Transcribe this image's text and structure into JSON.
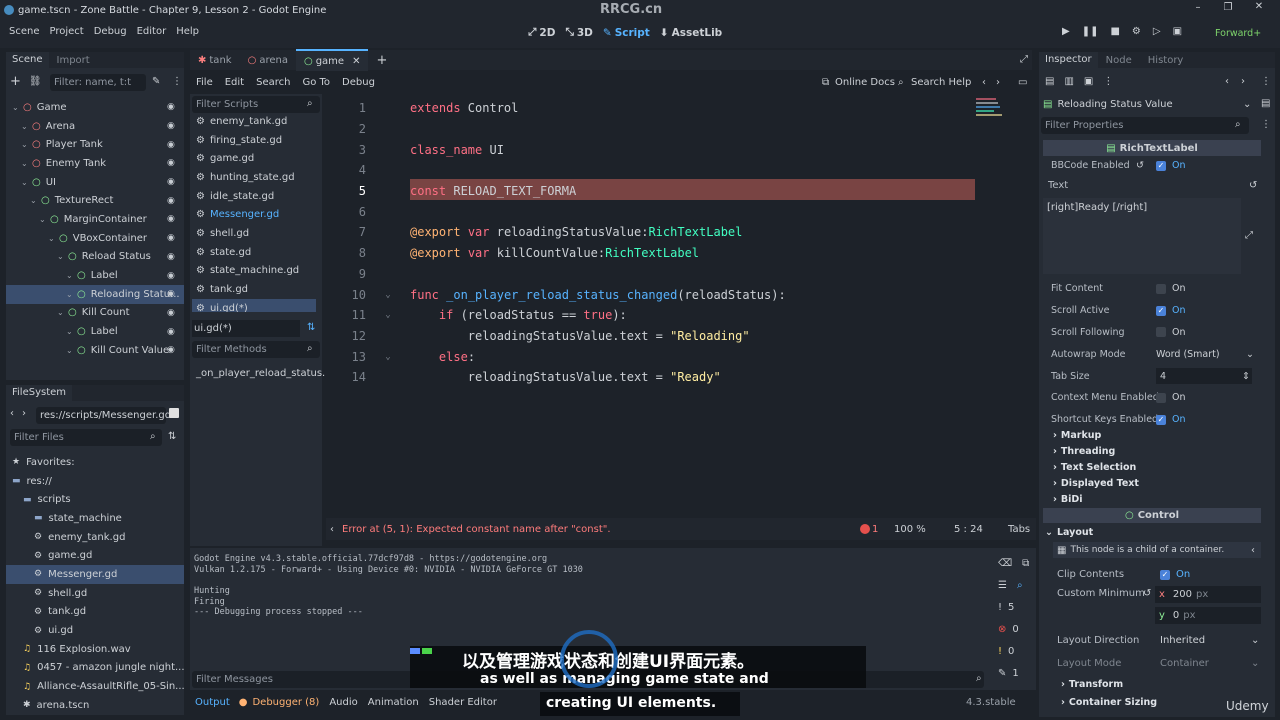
{
  "window": {
    "title": "game.tscn - Zone Battle - Chapter 9, Lesson 2 - Godot Engine",
    "watermark": "RRCG.cn"
  },
  "menu": {
    "items": [
      "Scene",
      "Project",
      "Debug",
      "Editor",
      "Help"
    ]
  },
  "workspaces": {
    "items": [
      "2D",
      "3D",
      "Script",
      "AssetLib"
    ],
    "active": "Script",
    "renderer": "Forward+"
  },
  "scene_dock": {
    "tabs": [
      "Scene",
      "Import"
    ],
    "filter_placeholder": "Filter: name, t:t",
    "nodes": [
      {
        "label": "Game",
        "indent": 0
      },
      {
        "label": "Arena",
        "indent": 1
      },
      {
        "label": "Player Tank",
        "indent": 1
      },
      {
        "label": "Enemy Tank",
        "indent": 1
      },
      {
        "label": "UI",
        "indent": 1
      },
      {
        "label": "TextureRect",
        "indent": 2
      },
      {
        "label": "MarginContainer",
        "indent": 3
      },
      {
        "label": "VBoxContainer",
        "indent": 4
      },
      {
        "label": "Reload Status",
        "indent": 5
      },
      {
        "label": "Label",
        "indent": 6
      },
      {
        "label": "Reloading Statu...",
        "indent": 6
      },
      {
        "label": "Kill Count",
        "indent": 5
      },
      {
        "label": "Label",
        "indent": 6
      },
      {
        "label": "Kill Count Value",
        "indent": 6
      }
    ],
    "selected_index": 10
  },
  "filesystem": {
    "tab": "FileSystem",
    "path": "res://scripts/Messenger.gd",
    "filter_placeholder": "Filter Files",
    "items": [
      {
        "label": "Favorites:",
        "indent": 0
      },
      {
        "label": "res://",
        "indent": 0
      },
      {
        "label": "scripts",
        "indent": 1
      },
      {
        "label": "state_machine",
        "indent": 2
      },
      {
        "label": "enemy_tank.gd",
        "indent": 2
      },
      {
        "label": "game.gd",
        "indent": 2
      },
      {
        "label": "Messenger.gd",
        "indent": 2
      },
      {
        "label": "shell.gd",
        "indent": 2
      },
      {
        "label": "tank.gd",
        "indent": 2
      },
      {
        "label": "ui.gd",
        "indent": 2
      },
      {
        "label": "116 Explosion.wav",
        "indent": 1
      },
      {
        "label": "0457 - amazon jungle night...",
        "indent": 1
      },
      {
        "label": "Alliance-AssaultRifle_05-Sin...",
        "indent": 1
      },
      {
        "label": "arena.tscn",
        "indent": 1
      }
    ],
    "selected_index": 6
  },
  "editor_tabs": {
    "items": [
      "tank",
      "arena",
      "game"
    ],
    "active": "game"
  },
  "script_menu": {
    "items": [
      "File",
      "Edit",
      "Search",
      "Go To",
      "Debug"
    ],
    "online_docs": "Online Docs",
    "search_help": "Search Help"
  },
  "script_list": {
    "filter_placeholder": "Filter Scripts",
    "items": [
      "enemy_tank.gd",
      "firing_state.gd",
      "game.gd",
      "hunting_state.gd",
      "idle_state.gd",
      "Messenger.gd",
      "shell.gd",
      "state.gd",
      "state_machine.gd",
      "tank.gd",
      "ui.gd(*)"
    ],
    "selected_index": 10,
    "current": "ui.gd(*)",
    "methods_placeholder": "Filter Methods",
    "methods": [
      "_on_player_reload_status..."
    ]
  },
  "code": {
    "lines": [
      {
        "n": "1",
        "t": [
          [
            "kw",
            "extends"
          ],
          [
            "",
            " Control"
          ]
        ]
      },
      {
        "n": "2",
        "t": []
      },
      {
        "n": "3",
        "t": [
          [
            "kw",
            "class_name"
          ],
          [
            "",
            " UI"
          ]
        ]
      },
      {
        "n": "4",
        "t": []
      },
      {
        "n": "5",
        "t": [
          [
            "kw",
            "const"
          ],
          [
            "",
            " RELOAD_TEXT_FORMA"
          ]
        ]
      },
      {
        "n": "6",
        "t": []
      },
      {
        "n": "7",
        "t": [
          [
            "an",
            "@export"
          ],
          [
            "",
            " "
          ],
          [
            "kw",
            "var"
          ],
          [
            "",
            " reloadingStatusValue:"
          ],
          [
            "ty",
            "RichTextLabel"
          ]
        ]
      },
      {
        "n": "8",
        "t": [
          [
            "an",
            "@export"
          ],
          [
            "",
            " "
          ],
          [
            "kw",
            "var"
          ],
          [
            "",
            " killCountValue:"
          ],
          [
            "ty",
            "RichTextLabel"
          ]
        ]
      },
      {
        "n": "9",
        "t": []
      },
      {
        "n": "10",
        "t": [
          [
            "kw",
            "func"
          ],
          [
            "",
            " "
          ],
          [
            "fn",
            "_on_player_reload_status_changed"
          ],
          [
            "",
            "(reloadStatus):"
          ]
        ]
      },
      {
        "n": "11",
        "t": [
          [
            "",
            "    "
          ],
          [
            "kw",
            "if"
          ],
          [
            "",
            " (reloadStatus == "
          ],
          [
            "kw",
            "true"
          ],
          [
            "",
            "):"
          ]
        ]
      },
      {
        "n": "12",
        "t": [
          [
            "",
            "        reloadingStatusValue.text = "
          ],
          [
            "st",
            "\"Reloading\""
          ]
        ]
      },
      {
        "n": "13",
        "t": [
          [
            "",
            "    "
          ],
          [
            "kw",
            "else"
          ],
          [
            "",
            ":"
          ]
        ]
      },
      {
        "n": "14",
        "t": [
          [
            "",
            "        reloadingStatusValue.text = "
          ],
          [
            "st",
            "\"Ready\""
          ]
        ]
      }
    ],
    "error_line": "5",
    "status_error": "Error at (5, 1): Expected constant name after \"const\".",
    "error_count": "1",
    "zoom": "100 %",
    "cursor": "5 :  24",
    "indent_mode": "Tabs"
  },
  "output": {
    "lines": [
      "Godot Engine v4.3.stable.official.77dcf97d8 - https://godotengine.org",
      "Vulkan 1.2.175 - Forward+ - Using Device #0: NVIDIA - NVIDIA GeForce GT 1030",
      "",
      "Hunting",
      "Firing",
      "--- Debugging process stopped ---"
    ],
    "filter_placeholder": "Filter Messages",
    "counters": [
      "5",
      "0",
      "0",
      "1"
    ]
  },
  "bottom_tabs": {
    "items": [
      "Output",
      "Debugger (8)",
      "Audio",
      "Animation",
      "Shader Editor"
    ],
    "version": "4.3.stable"
  },
  "inspector": {
    "tabs": [
      "Inspector",
      "Node",
      "History"
    ],
    "object": "Reloading Status Value",
    "filter_placeholder": "Filter Properties",
    "class": "RichTextLabel",
    "props": [
      {
        "label": "BBCode Enabled",
        "value": "On",
        "checked": true
      },
      {
        "label": "Fit Content",
        "value": "On",
        "checked": false
      },
      {
        "label": "Scroll Active",
        "value": "On",
        "checked": true
      },
      {
        "label": "Scroll Following",
        "value": "On",
        "checked": false
      },
      {
        "label": "Autowrap Mode",
        "value": "Word (Smart)",
        "checked": null
      },
      {
        "label": "Tab Size",
        "value": "4",
        "checked": null
      },
      {
        "label": "Context Menu Enabled",
        "value": "On",
        "checked": false
      },
      {
        "label": "Shortcut Keys Enabled",
        "value": "On",
        "checked": true
      }
    ],
    "text_label": "Text",
    "text_value": "[right]Ready [/right]",
    "sections": [
      "Markup",
      "Threading",
      "Text Selection",
      "Displayed Text",
      "BiDi"
    ],
    "control_class": "Control",
    "layout_section": "Layout",
    "container_note": "This node is a child of a container.",
    "clip_label": "Clip Contents",
    "clip_value": "On",
    "min_label": "Custom Minimum",
    "min_x": "200",
    "min_y": "0",
    "unit": "px",
    "dir_label": "Layout Direction",
    "dir_value": "Inherited",
    "mode_label": "Layout Mode",
    "mode_value": "Container",
    "subsections": [
      "Transform",
      "Container Sizing"
    ]
  },
  "subtitles": {
    "line_cn": "以及管理游戏状态和创建UI界面元素。",
    "line_en1": "as well as managing game state and",
    "line_en2": "creating UI elements."
  },
  "brand": "Udemy"
}
